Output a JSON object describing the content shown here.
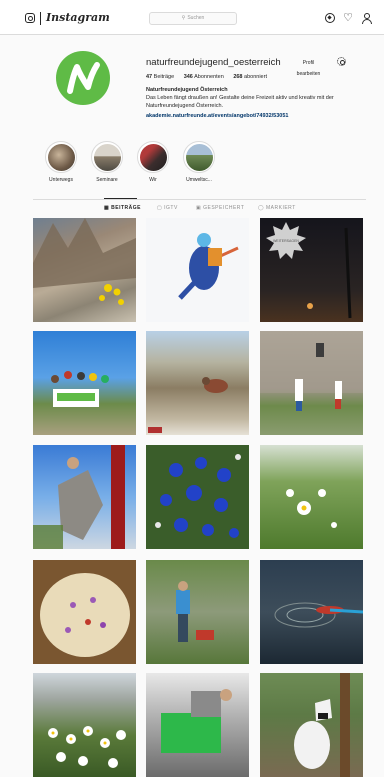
{
  "topbar": {
    "wordmark": "Instagram",
    "search_placeholder": "Suchen",
    "icons": [
      "instagram-glyph-icon",
      "search-icon",
      "compass-icon",
      "heart-icon",
      "profile-icon"
    ]
  },
  "profile": {
    "username": "naturfreundejugend_oesterreich",
    "edit_label": "Profil bearbeiten",
    "stats": [
      {
        "value": "47",
        "label": "Beiträge"
      },
      {
        "value": "346",
        "label": "Abonnenten"
      },
      {
        "value": "268",
        "label": "abonniert"
      }
    ],
    "full_name": "Naturfreundejugend Österreich",
    "bio": "Das Leben fängt draußen an! Gestalte deine Freizeit aktiv und kreativ mit der Naturfreundejugend Österreich.",
    "link": "akademie.naturfreunde.at/events/angebot/74932/53051",
    "avatar_color": "#5fbb46"
  },
  "highlights": [
    {
      "label": "Unterwegs"
    },
    {
      "label": "Seminare"
    },
    {
      "label": "Wir"
    },
    {
      "label": "Umweltsc..."
    }
  ],
  "tabs": [
    {
      "label": "BEITRÄGE",
      "icon": "grid-icon",
      "active": true
    },
    {
      "label": "IGTV",
      "icon": "igtv-icon",
      "active": false
    },
    {
      "label": "GESPEICHERT",
      "icon": "bookmark-icon",
      "active": false
    },
    {
      "label": "MARKIERT",
      "icon": "tag-icon",
      "active": false
    }
  ],
  "posts": [
    {
      "subject": "rocky mountain scree with yellow flowers"
    },
    {
      "subject": "climber in blue jacket on white background"
    },
    {
      "subject": "night sky starburst badge"
    },
    {
      "subject": "group with banner on mountain top"
    },
    {
      "subject": "person resting on alpine meadow"
    },
    {
      "subject": "people at stone climbing wall"
    },
    {
      "subject": "climber from below against sky"
    },
    {
      "subject": "blue gentian flowers"
    },
    {
      "subject": "daisies in green meadow"
    },
    {
      "subject": "bowl of food with flowers"
    },
    {
      "subject": "hiker on rocky slope"
    },
    {
      "subject": "paddle in dark water"
    },
    {
      "subject": "white alpine flowers"
    },
    {
      "subject": "person in green climbing gear"
    },
    {
      "subject": "goat on wooden post"
    }
  ],
  "badge_text": "WEITERSAGEN",
  "colors": {
    "link": "#003569",
    "border": "#dbdbdb",
    "background": "#fafafa"
  }
}
